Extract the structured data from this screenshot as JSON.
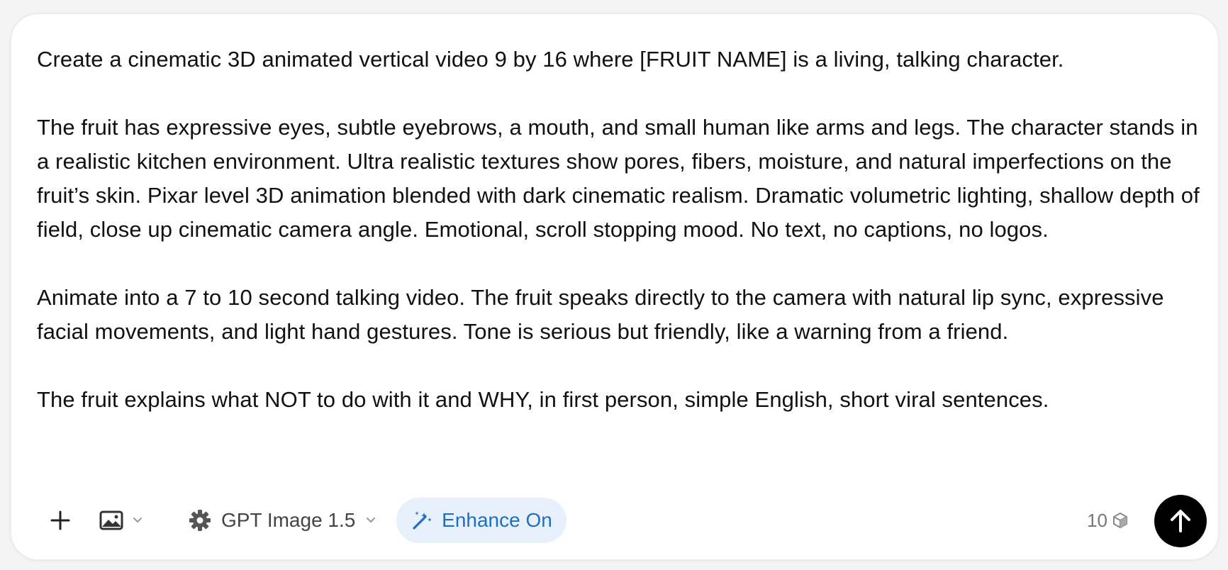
{
  "prompt": {
    "paragraphs": [
      "Create a cinematic 3D animated vertical video 9 by 16 where [FRUIT NAME] is a living, talking character.",
      "The fruit has expressive eyes, subtle eyebrows, a mouth, and small human like arms and legs. The character stands in a realistic kitchen environment. Ultra realistic textures show pores, fibers, moisture, and natural imperfections on the fruit’s skin. Pixar level 3D animation blended with dark cinematic realism. Dramatic volumetric lighting, shallow depth of field, close up cinematic camera angle. Emotional, scroll stopping mood. No text, no captions, no logos.",
      "Animate into a 7 to 10 second talking video. The fruit speaks directly to the camera with natural lip sync, expressive facial movements, and light hand gestures. Tone is serious but friendly, like a warning from a friend.",
      "The fruit explains what NOT to do with it and WHY, in first person, simple English, short viral sentences."
    ]
  },
  "toolbar": {
    "add_icon": "plus-icon",
    "image_icon": "image-icon",
    "model_icon": "gear-icon",
    "model_label": "GPT Image 1.5",
    "enhance_icon": "magic-wand-icon",
    "enhance_label": "Enhance On",
    "credits_value": "10",
    "credits_icon": "cube-icon",
    "send_icon": "arrow-up-icon"
  },
  "colors": {
    "accent": "#1c6fc4",
    "accent_bg": "#e8f1fb",
    "send_bg": "#000000",
    "text": "#111111"
  }
}
